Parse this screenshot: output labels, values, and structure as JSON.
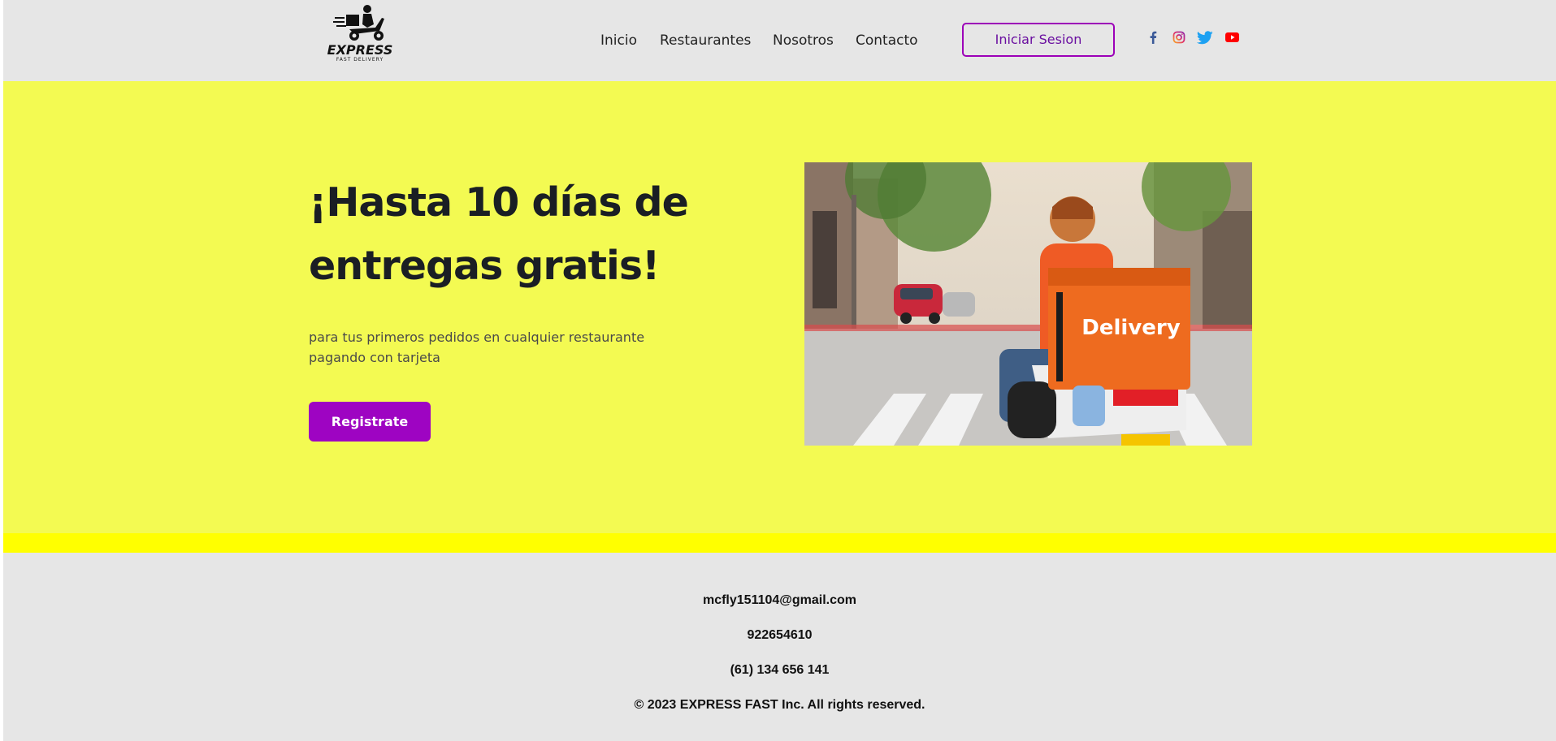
{
  "header": {
    "logo": {
      "wordmark": "EXPRESS",
      "tagline": "FAST DELIVERY"
    },
    "nav": [
      {
        "label": "Inicio"
      },
      {
        "label": "Restaurantes"
      },
      {
        "label": "Nosotros"
      },
      {
        "label": "Contacto"
      }
    ],
    "login_label": "Iniciar Sesion",
    "social": [
      {
        "icon": "facebook-icon",
        "color": "#3b5998"
      },
      {
        "icon": "instagram-icon",
        "color": "#e1306c"
      },
      {
        "icon": "twitter-icon",
        "color": "#1da1f2"
      },
      {
        "icon": "youtube-icon",
        "color": "#ff0000"
      }
    ]
  },
  "hero": {
    "title": "¡Hasta 10 días de entregas gratis!",
    "subtitle": "para tus primeros pedidos en cualquier restaurante pagando con tarjeta",
    "register_label": "Registrate",
    "photo": {
      "box_text": "Delivery"
    }
  },
  "footer": {
    "email": "mcfly151104@gmail.com",
    "phone_1": "922654610",
    "phone_2": "(61) 134 656 141",
    "copyright": "© 2023 EXPRESS FAST Inc. All rights reserved."
  },
  "colors": {
    "header_bg": "#e6e6e6",
    "hero_bg": "#f3fa52",
    "band": "#ffff00",
    "accent": "#9e04c2"
  }
}
